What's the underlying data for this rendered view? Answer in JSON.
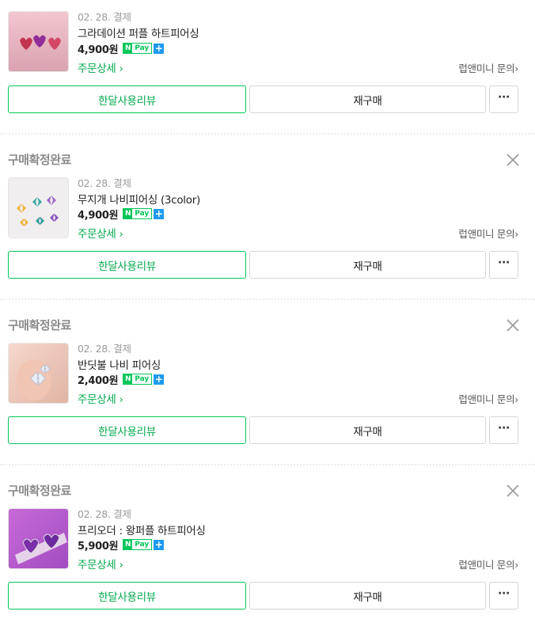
{
  "orders": [
    {
      "status": "",
      "date": "02. 28. 결제",
      "name": "그라데이션 퍼플 하트피어싱",
      "price": "4,900원",
      "detail": "주문상세",
      "seller_inquiry": "럽앤미니 문의",
      "review_button": "한달사용리뷰",
      "rebuy_button": "재구매",
      "more_button": "···",
      "thumbnail_icon": "heart-earrings-image"
    },
    {
      "status": "구매확정완료",
      "date": "02. 28. 결제",
      "name": "무지개 나비피어싱 (3color)",
      "price": "4,900원",
      "detail": "주문상세",
      "seller_inquiry": "럽앤미니 문의",
      "review_button": "한달사용리뷰",
      "rebuy_button": "재구매",
      "more_button": "···",
      "thumbnail_icon": "butterfly-earrings-image"
    },
    {
      "status": "구매확정완료",
      "date": "02. 28. 결제",
      "name": "반딧불 나비 피어싱",
      "price": "2,400원",
      "detail": "주문상세",
      "seller_inquiry": "럽앤미니 문의",
      "review_button": "한달사용리뷰",
      "rebuy_button": "재구매",
      "more_button": "···",
      "thumbnail_icon": "firefly-butterfly-earring-image"
    },
    {
      "status": "구매확정완료",
      "date": "02. 28. 결제",
      "name": "프리오더 : 왕퍼플 하트피어싱",
      "price": "5,900원",
      "detail": "주문상세",
      "seller_inquiry": "럽앤미니 문의",
      "review_button": "한달사용리뷰",
      "rebuy_button": "재구매",
      "more_button": "···",
      "thumbnail_icon": "purple-heart-earrings-image"
    }
  ],
  "npay": {
    "n": "N",
    "pay": "Pay",
    "plus": "+"
  },
  "colors": {
    "accent": "#03c75a",
    "text_green": "#03a94d",
    "npay_plus": "#1d9bf0",
    "status_gray": "#8a8a8a"
  }
}
